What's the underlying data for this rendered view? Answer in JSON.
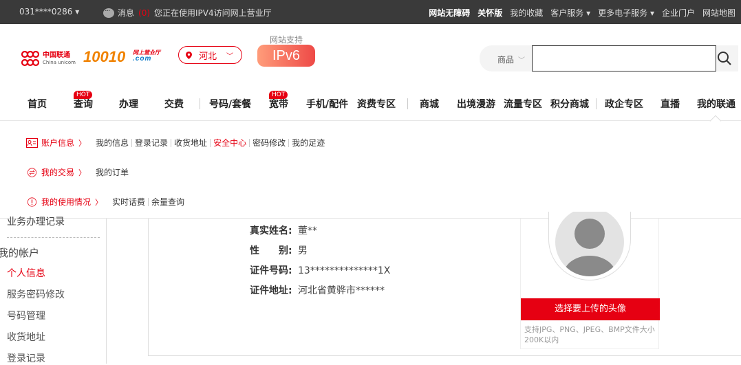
{
  "topbar": {
    "phone": "031****0286",
    "msg_label": "消息",
    "msg_count": "(0)",
    "notice": "您正在使用IPV4访问网上营业厅",
    "links": [
      "网站无障碍",
      "关怀版",
      "我的收藏",
      "客户服务 ▾",
      "更多电子服务 ▾",
      "企业门户",
      "网站地图"
    ]
  },
  "header": {
    "logo_cn": "中国联通",
    "logo_en": "China unicom",
    "logo_10010": "10010",
    "logo_sub1": "网上营业厅",
    "logo_sub2": ".com",
    "province": "河北",
    "ipv6_label": "网站支持",
    "ipv6_badge": "IPv6",
    "search_category": "商品",
    "search_placeholder": ""
  },
  "nav": {
    "items": [
      "首页",
      "查询",
      "办理",
      "交费",
      "号码/套餐",
      "宽带",
      "手机/配件",
      "资费专区",
      "商城",
      "出境漫游",
      "流量专区",
      "积分商城",
      "政企专区",
      "直播",
      "我的联通"
    ],
    "hot_label": "HOT"
  },
  "dropdown": {
    "account": {
      "title": "账户信息",
      "links": [
        "我的信息",
        "登录记录",
        "收货地址",
        "安全中心",
        "密码修改",
        "我的足迹"
      ]
    },
    "trade": {
      "title": "我的交易",
      "links": [
        "我的订单"
      ]
    },
    "usage": {
      "title": "我的使用情况",
      "links": [
        "实时话费",
        "余量查询"
      ]
    }
  },
  "sidebar": {
    "cut_item": "业务办理记录",
    "group": "我的帐户",
    "items": [
      "个人信息",
      "服务密码修改",
      "号码管理",
      "收货地址",
      "登录记录"
    ]
  },
  "profile": {
    "name_label": "真实姓名:",
    "name": "董**",
    "gender_label": "性　　别:",
    "gender": "男",
    "id_label": "证件号码:",
    "id": "13**************1X",
    "addr_label": "证件地址:",
    "addr": "河北省黄骅市******",
    "upload_button": "选择要上传的头像",
    "upload_note": "支持JPG、PNG、JPEG、BMP文件大小200K以内"
  },
  "colors": {
    "brand": "#e60012",
    "topbar": "#3a3a3a",
    "orange": "#f08200"
  }
}
